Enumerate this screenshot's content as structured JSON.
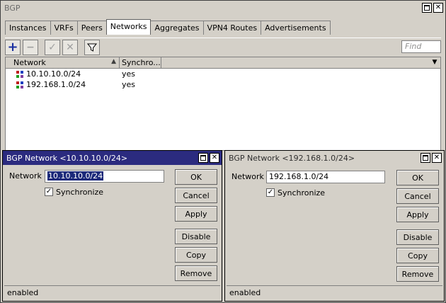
{
  "main_window": {
    "title": "BGP",
    "tabs": [
      "Instances",
      "VRFs",
      "Peers",
      "Networks",
      "Aggregates",
      "VPN4 Routes",
      "Advertisements"
    ],
    "selected_tab": "Networks",
    "find_placeholder": "Find",
    "columns": [
      "Network",
      "Synchro..."
    ],
    "rows": [
      {
        "network": "10.10.10.0/24",
        "synchronize": "yes"
      },
      {
        "network": "192.168.1.0/24",
        "synchronize": "yes"
      }
    ],
    "toolbar": {
      "add_icon": "plus-icon",
      "remove_icon": "minus-icon",
      "enable_icon": "check-icon",
      "disable_icon": "cross-icon",
      "filter_icon": "filter-icon"
    }
  },
  "dialog1": {
    "title": "BGP Network <10.10.10.0/24>",
    "network_label": "Network",
    "network_value": "10.10.10.0/24",
    "synchronize_label": "Synchronize",
    "synchronize_checked": true,
    "buttons": [
      "OK",
      "Cancel",
      "Apply",
      "Disable",
      "Copy",
      "Remove"
    ],
    "status": "enabled"
  },
  "dialog2": {
    "title": "BGP Network <192.168.1.0/24>",
    "network_label": "Network",
    "network_value": "192.168.1.0/24",
    "synchronize_label": "Synchronize",
    "synchronize_checked": true,
    "buttons": [
      "OK",
      "Cancel",
      "Apply",
      "Disable",
      "Copy",
      "Remove"
    ],
    "status": "enabled"
  },
  "colors": {
    "active_title": "#2b2b7f",
    "selection": "#1c2a7a",
    "add_icon": "#1a2fa0"
  }
}
